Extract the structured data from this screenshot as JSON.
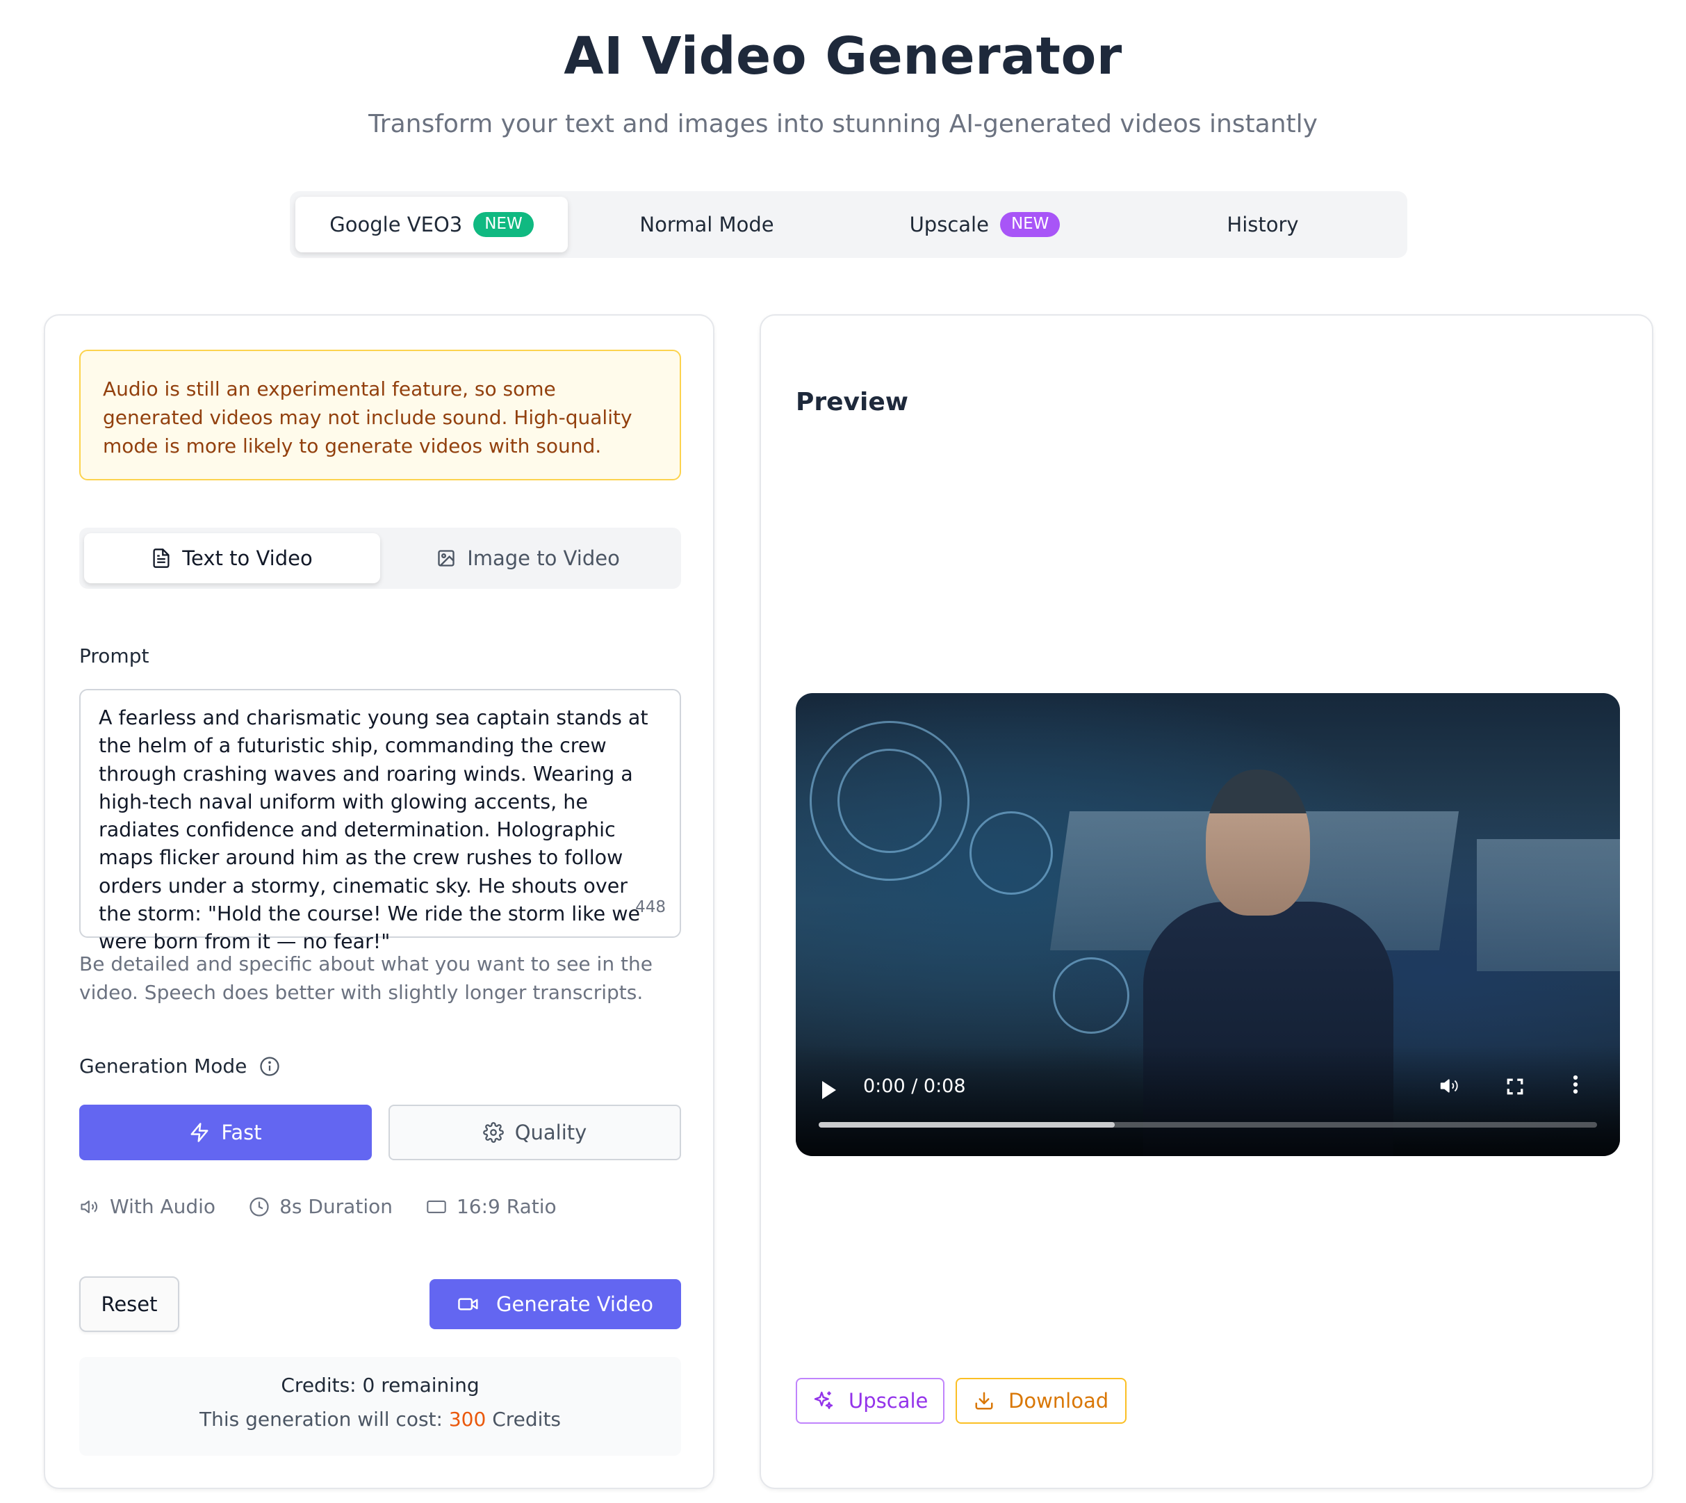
{
  "header": {
    "title": "AI Video Generator",
    "subtitle": "Transform your text and images into stunning AI-generated videos instantly"
  },
  "tabs": [
    {
      "label": "Google VEO3",
      "badge": "NEW",
      "active": true
    },
    {
      "label": "Normal Mode"
    },
    {
      "label": "Upscale",
      "badge": "NEW"
    },
    {
      "label": "History"
    }
  ],
  "warning": {
    "text": "Audio is still an experimental feature, so some generated videos may not include sound. High-quality mode is more likely to generate videos with sound."
  },
  "input_mode": {
    "text_to_video": "Text to Video",
    "image_to_video": "Image to Video",
    "selected": "Text to Video"
  },
  "prompt": {
    "label": "Prompt",
    "value": "A fearless and charismatic young sea captain stands at the helm of a futuristic ship, commanding the crew through crashing waves and roaring winds. Wearing a high-tech naval uniform with glowing accents, he radiates confidence and determination. Holographic maps flicker around him as the crew rushes to follow orders under a stormy, cinematic sky. He shouts over the storm: \"Hold the course! We ride the storm like we were born from it — no fear!\"",
    "char_count": "448",
    "helper": "Be detailed and specific about what you want to see in the video. Speech does better with slightly longer transcripts."
  },
  "generation_mode": {
    "label": "Generation Mode",
    "fast": "Fast",
    "quality": "Quality",
    "selected": "Fast"
  },
  "specs": {
    "audio": "With Audio",
    "duration": "8s Duration",
    "ratio": "16:9 Ratio"
  },
  "actions": {
    "reset": "Reset",
    "generate": "Generate Video"
  },
  "credits": {
    "remaining": "Credits: 0 remaining",
    "cost_prefix": "This generation will cost:",
    "cost_value": "300",
    "cost_suffix": "Credits"
  },
  "preview": {
    "title": "Preview",
    "time": "0:00 / 0:08",
    "progress_fraction": 0.38,
    "upscale": "Upscale",
    "download": "Download"
  },
  "colors": {
    "accent": "#6366f1",
    "badge_green": "#10b981",
    "badge_purple": "#a855f7",
    "warning_bg": "#fffbeb",
    "warning_text": "#92400e",
    "cost": "#ea580c"
  }
}
